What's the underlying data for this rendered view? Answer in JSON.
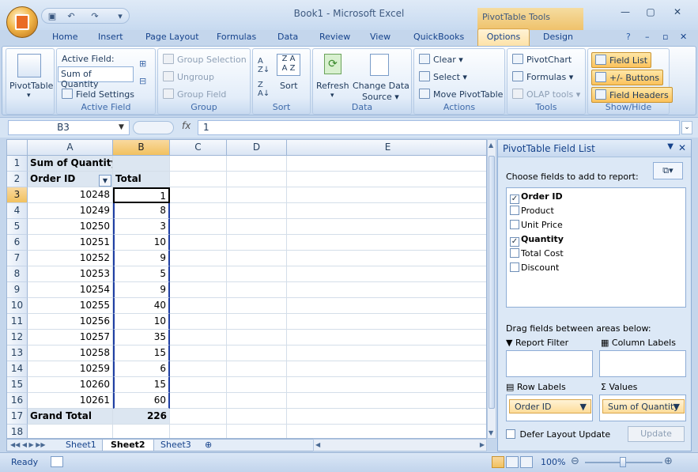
{
  "window": {
    "title": "Book1 - Microsoft Excel",
    "context_group": "PivotTable Tools"
  },
  "tabs": [
    "Home",
    "Insert",
    "Page Layout",
    "Formulas",
    "Data",
    "Review",
    "View",
    "QuickBooks",
    "Options",
    "Design"
  ],
  "ribbon": {
    "pivottable": {
      "label": "PivotTable"
    },
    "active_field": {
      "title": "Active Field:",
      "value": "Sum of Quantity",
      "settings": "Field Settings",
      "group": "Active Field"
    },
    "group": {
      "selection": "Group Selection",
      "ungroup": "Ungroup",
      "field": "Group Field",
      "group": "Group"
    },
    "sort": {
      "label": "Sort",
      "group": "Sort"
    },
    "data": {
      "refresh": "Refresh",
      "change_source_l1": "Change Data",
      "change_source_l2": "Source",
      "group": "Data"
    },
    "actions": {
      "clear": "Clear",
      "select": "Select",
      "move": "Move PivotTable",
      "group": "Actions"
    },
    "tools": {
      "pivotchart": "PivotChart",
      "formulas": "Formulas",
      "olap": "OLAP tools",
      "group": "Tools"
    },
    "showhide": {
      "field_list": "Field List",
      "buttons": "+/- Buttons",
      "headers": "Field Headers",
      "group": "Show/Hide"
    }
  },
  "formula_bar": {
    "name_box": "B3",
    "fx": "fx",
    "value": "1"
  },
  "sheet": {
    "columns": [
      "A",
      "B",
      "C",
      "D",
      "E"
    ],
    "rows": [
      "1",
      "2",
      "3",
      "4",
      "5",
      "6",
      "7",
      "8",
      "9",
      "10",
      "11",
      "12",
      "13",
      "14",
      "15",
      "16",
      "17",
      "18"
    ],
    "a1": "Sum of Quantity",
    "a2": "Order ID",
    "b2": "Total",
    "data": [
      {
        "id": "10248",
        "qty": "1"
      },
      {
        "id": "10249",
        "qty": "8"
      },
      {
        "id": "10250",
        "qty": "3"
      },
      {
        "id": "10251",
        "qty": "10"
      },
      {
        "id": "10252",
        "qty": "9"
      },
      {
        "id": "10253",
        "qty": "5"
      },
      {
        "id": "10254",
        "qty": "9"
      },
      {
        "id": "10255",
        "qty": "40"
      },
      {
        "id": "10256",
        "qty": "10"
      },
      {
        "id": "10257",
        "qty": "35"
      },
      {
        "id": "10258",
        "qty": "15"
      },
      {
        "id": "10259",
        "qty": "6"
      },
      {
        "id": "10260",
        "qty": "15"
      },
      {
        "id": "10261",
        "qty": "60"
      }
    ],
    "grand_total_label": "Grand Total",
    "grand_total": "226",
    "tabs": [
      "Sheet1",
      "Sheet2",
      "Sheet3"
    ]
  },
  "field_list": {
    "title": "PivotTable Field List",
    "choose": "Choose fields to add to report:",
    "fields": [
      {
        "name": "Order ID",
        "checked": true
      },
      {
        "name": "Product",
        "checked": false
      },
      {
        "name": "Unit Price",
        "checked": false
      },
      {
        "name": "Quantity",
        "checked": true
      },
      {
        "name": "Total Cost",
        "checked": false
      },
      {
        "name": "Discount",
        "checked": false
      }
    ],
    "drag": "Drag fields between areas below:",
    "report_filter": "Report Filter",
    "column_labels": "Column Labels",
    "row_labels": "Row Labels",
    "values": "Values",
    "row_item": "Order ID",
    "value_item": "Sum of Quantity",
    "defer": "Defer Layout Update",
    "update": "Update"
  },
  "status": {
    "ready": "Ready",
    "zoom": "100%"
  }
}
